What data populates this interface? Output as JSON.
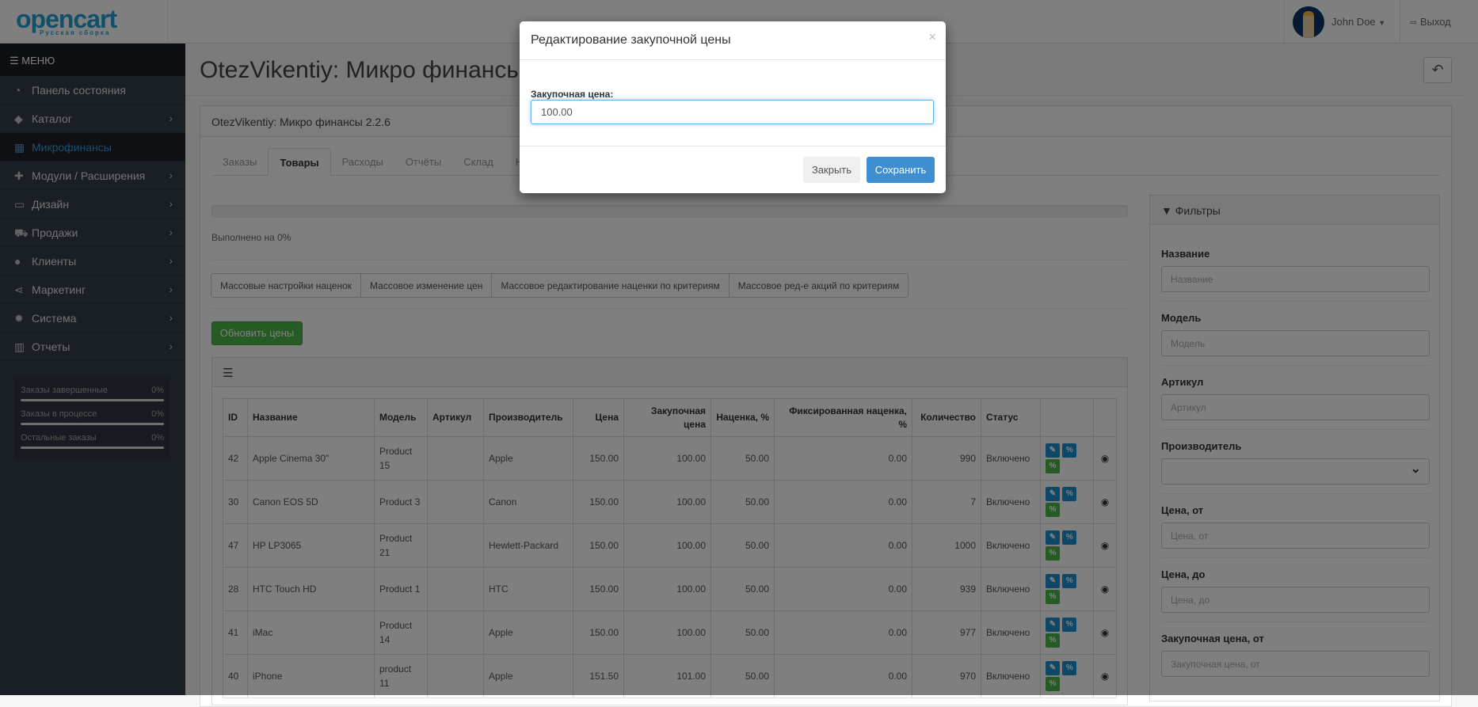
{
  "header": {
    "logo_text": "opencart",
    "logo_sub": "Русская сборка",
    "user_name": "John Doe",
    "logout": "Выход"
  },
  "sidebar": {
    "menu_label": "МЕНЮ",
    "items": [
      {
        "label": "Панель состояния",
        "icon": "dashboard-icon",
        "glyph": "◔",
        "chevron": false
      },
      {
        "label": "Каталог",
        "icon": "tags-icon",
        "glyph": "◆",
        "chevron": true
      },
      {
        "label": "Микрофинансы",
        "icon": "calculator-icon",
        "glyph": "▦",
        "chevron": false,
        "active": true
      },
      {
        "label": "Модули / Расширения",
        "icon": "puzzle-icon",
        "glyph": "✚",
        "chevron": true
      },
      {
        "label": "Дизайн",
        "icon": "monitor-icon",
        "glyph": "▭",
        "chevron": true
      },
      {
        "label": "Продажи",
        "icon": "cart-icon",
        "glyph": "⛟",
        "chevron": true
      },
      {
        "label": "Клиенты",
        "icon": "user-icon",
        "glyph": "●",
        "chevron": true
      },
      {
        "label": "Маркетинг",
        "icon": "share-icon",
        "glyph": "⋖",
        "chevron": true
      },
      {
        "label": "Система",
        "icon": "gear-icon",
        "glyph": "✹",
        "chevron": true
      },
      {
        "label": "Отчеты",
        "icon": "bar-chart-icon",
        "glyph": "▥",
        "chevron": true
      }
    ],
    "stats": [
      {
        "label": "Заказы завершенные",
        "value": "0%"
      },
      {
        "label": "Заказы в процессе",
        "value": "0%"
      },
      {
        "label": "Остальные заказы",
        "value": "0%"
      }
    ]
  },
  "page": {
    "title": "OtezVikentiy: Микро финансы",
    "panel_title": "OtezVikentiy: Микро финансы 2.2.6",
    "tabs": [
      "Заказы",
      "Товары",
      "Расходы",
      "Отчёты",
      "Склад",
      "Н"
    ],
    "active_tab": 1,
    "progress": 0,
    "progress_text": "Выполнено на 0%",
    "mass_buttons": [
      "Массовые настройки наценок",
      "Массовое изменение цен",
      "Массовое редактирование наценки по критериям",
      "Массовое ред-е акций по критериям"
    ],
    "update_button": "Обновить цены"
  },
  "table": {
    "columns": [
      "ID",
      "Название",
      "Модель",
      "Артикул",
      "Производитель",
      "Цена",
      "Закупочная цена",
      "Наценка, %",
      "Фиксированная наценка, %",
      "Количество",
      "Статус",
      "",
      ""
    ],
    "rows": [
      [
        "42",
        "Apple Cinema 30\"",
        "Product 15",
        "",
        "Apple",
        "150.00",
        "100.00",
        "50.00",
        "0.00",
        "990",
        "Включено"
      ],
      [
        "30",
        "Canon EOS 5D",
        "Product 3",
        "",
        "Canon",
        "150.00",
        "100.00",
        "50.00",
        "0.00",
        "7",
        "Включено"
      ],
      [
        "47",
        "HP LP3065",
        "Product 21",
        "",
        "Hewlett-Packard",
        "150.00",
        "100.00",
        "50.00",
        "0.00",
        "1000",
        "Включено"
      ],
      [
        "28",
        "HTC Touch HD",
        "Product 1",
        "",
        "HTC",
        "150.00",
        "100.00",
        "50.00",
        "0.00",
        "939",
        "Включено"
      ],
      [
        "41",
        "iMac",
        "Product 14",
        "",
        "Apple",
        "150.00",
        "100.00",
        "50.00",
        "0.00",
        "977",
        "Включено"
      ],
      [
        "40",
        "iPhone",
        "product 11",
        "",
        "Apple",
        "151.50",
        "101.00",
        "50.00",
        "0.00",
        "970",
        "Включено"
      ]
    ]
  },
  "filters": {
    "title": "Фильтры",
    "fields": [
      {
        "label": "Название",
        "placeholder": "Название"
      },
      {
        "label": "Модель",
        "placeholder": "Модель"
      },
      {
        "label": "Артикул",
        "placeholder": "Артикул"
      },
      {
        "label": "Производитель",
        "select": true
      },
      {
        "label": "Цена, от",
        "placeholder": "Цена, от"
      },
      {
        "label": "Цена, до",
        "placeholder": "Цена, до"
      },
      {
        "label": "Закупочная цена, от",
        "placeholder": "Закупочная цена, от"
      }
    ]
  },
  "modal": {
    "title": "Редактирование закупочной цены",
    "close_glyph": "×",
    "label": "Закупочная цена:",
    "value": "100.00",
    "cancel": "Закрыть",
    "save": "Сохранить"
  }
}
